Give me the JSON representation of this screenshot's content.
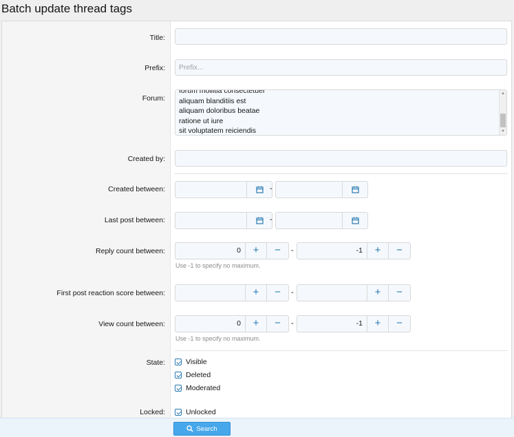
{
  "page": {
    "title": "Batch update thread tags"
  },
  "fields": {
    "title": {
      "label": "Title:",
      "value": ""
    },
    "prefix": {
      "label": "Prefix:",
      "placeholder": "Prefix..."
    },
    "forum": {
      "label": "Forum:",
      "items": [
        "forum mollitia consectetuer",
        "aliquam blanditiis est",
        "aliquam doloribus beatae",
        "ratione ut iure",
        "sit voluptatem reiciendis"
      ]
    },
    "created_by": {
      "label": "Created by:",
      "value": ""
    },
    "created_between": {
      "label": "Created between:",
      "dash": "-"
    },
    "last_post_between": {
      "label": "Last post between:",
      "dash": "-"
    },
    "reply_count": {
      "label": "Reply count between:",
      "min": "0",
      "max": "-1",
      "dash": "-",
      "hint": "Use -1 to specify no maximum."
    },
    "first_post_reaction": {
      "label": "First post reaction score between:",
      "min": "",
      "max": "",
      "dash": "-"
    },
    "view_count": {
      "label": "View count between:",
      "min": "0",
      "max": "-1",
      "dash": "-",
      "hint": "Use -1 to specify no maximum."
    },
    "state": {
      "label": "State:",
      "options": [
        "Visible",
        "Deleted",
        "Moderated"
      ]
    },
    "locked": {
      "label": "Locked:",
      "options": [
        "Unlocked"
      ]
    }
  },
  "buttons": {
    "plus": "+",
    "minus": "−",
    "search": "Search"
  },
  "icons": {
    "calendar": "calendar-icon",
    "search": "search-icon"
  },
  "colors": {
    "accent": "#2577b1",
    "button": "#47a7eb"
  }
}
